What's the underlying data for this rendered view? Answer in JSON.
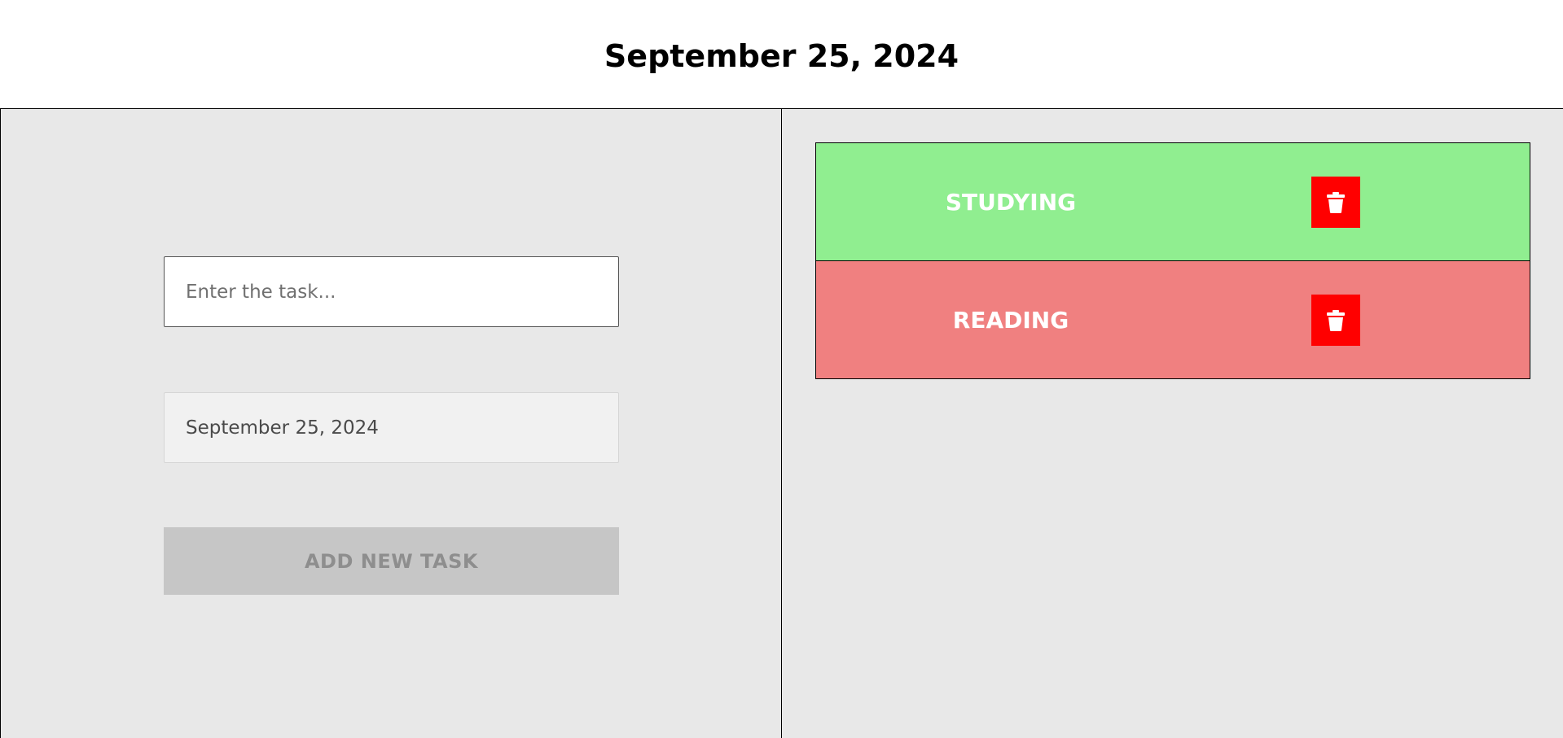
{
  "header": {
    "title": "September 25, 2024"
  },
  "form": {
    "task_placeholder": "Enter the task...",
    "task_value": "",
    "date_value": "September 25, 2024",
    "add_button_label": "ADD NEW TASK"
  },
  "tasks": [
    {
      "name": "STUDYING",
      "color": "#90ee90",
      "delete_icon": "trash-icon"
    },
    {
      "name": "READING",
      "color": "#f08080",
      "delete_icon": "trash-icon"
    }
  ],
  "colors": {
    "panel_background": "#e8e8e8",
    "delete_button": "#ff0000",
    "add_button_background": "#c6c6c6",
    "add_button_text": "#8e8e8e"
  }
}
